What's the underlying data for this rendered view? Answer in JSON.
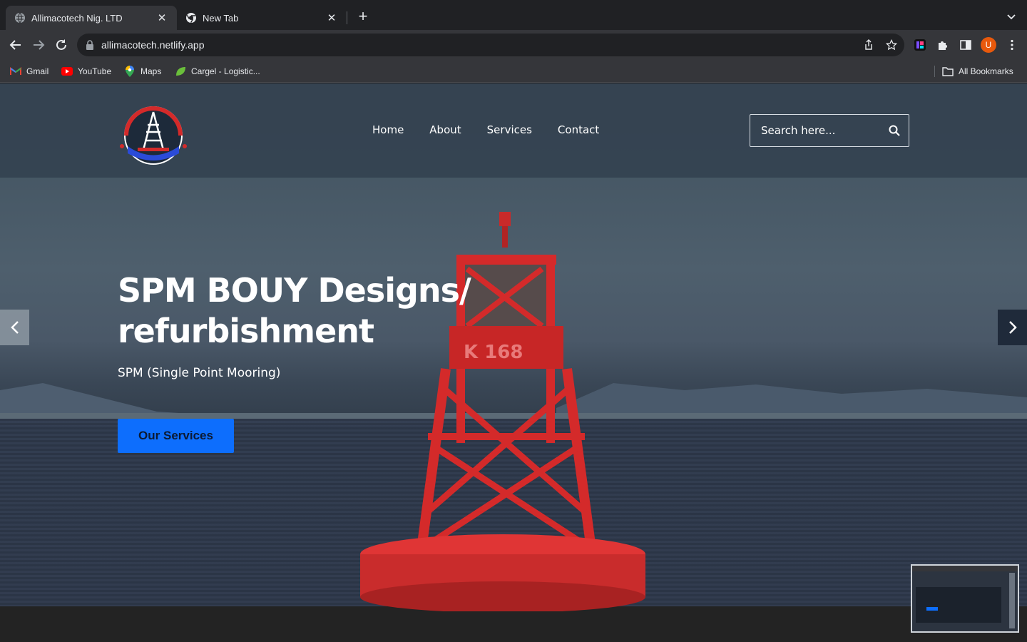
{
  "browser": {
    "tabs": [
      {
        "title": "Allimacotech Nig. LTD",
        "active": true
      },
      {
        "title": "New Tab",
        "active": false
      }
    ],
    "url": "allimacotech.netlify.app",
    "avatar_letter": "U",
    "bookmarks": [
      {
        "label": "Gmail",
        "icon": "gmail-icon"
      },
      {
        "label": "YouTube",
        "icon": "youtube-icon"
      },
      {
        "label": "Maps",
        "icon": "maps-icon"
      },
      {
        "label": "Cargel - Logistic...",
        "icon": "cargel-icon"
      }
    ],
    "all_bookmarks_label": "All Bookmarks"
  },
  "site": {
    "nav": [
      {
        "label": "Home"
      },
      {
        "label": "About"
      },
      {
        "label": "Services"
      },
      {
        "label": "Contact"
      }
    ],
    "search_placeholder": "Search here...",
    "hero": {
      "title": "SPM BOUY Designs/ refurbishment",
      "subtitle": "SPM (Single Point Mooring)",
      "cta_label": "Our Services"
    },
    "colors": {
      "header_bg": "#344250",
      "cta_bg": "#0d6efd",
      "buoy_red": "#d42a2a"
    }
  }
}
